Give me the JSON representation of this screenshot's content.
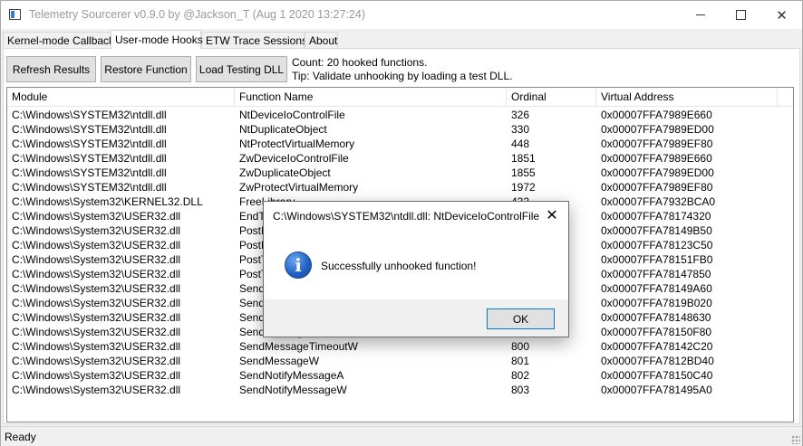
{
  "window": {
    "title": "Telemetry Sourcerer v0.9.0 by @Jackson_T (Aug  1 2020 13:27:24)",
    "controls": {
      "minimize": "minimize-icon",
      "maximize": "maximize-icon",
      "close": "close-icon"
    }
  },
  "tabs": [
    {
      "label": "Kernel-mode Callbacks",
      "active": false
    },
    {
      "label": "User-mode Hooks",
      "active": true
    },
    {
      "label": "ETW Trace Sessions",
      "active": false
    },
    {
      "label": "About",
      "active": false
    }
  ],
  "toolbar": {
    "refresh_label": "Refresh Results",
    "restore_label": "Restore Function",
    "load_label": "Load Testing DLL",
    "count_text": "Count: 20 hooked functions.",
    "tip_text": "Tip: Validate unhooking by loading a test DLL."
  },
  "table": {
    "columns": [
      "Module",
      "Function Name",
      "Ordinal",
      "Virtual Address"
    ],
    "rows": [
      [
        "C:\\Windows\\SYSTEM32\\ntdll.dll",
        "NtDeviceIoControlFile",
        "326",
        "0x00007FFA7989E660"
      ],
      [
        "C:\\Windows\\SYSTEM32\\ntdll.dll",
        "NtDuplicateObject",
        "330",
        "0x00007FFA7989ED00"
      ],
      [
        "C:\\Windows\\SYSTEM32\\ntdll.dll",
        "NtProtectVirtualMemory",
        "448",
        "0x00007FFA7989EF80"
      ],
      [
        "C:\\Windows\\SYSTEM32\\ntdll.dll",
        "ZwDeviceIoControlFile",
        "1851",
        "0x00007FFA7989E660"
      ],
      [
        "C:\\Windows\\SYSTEM32\\ntdll.dll",
        "ZwDuplicateObject",
        "1855",
        "0x00007FFA7989ED00"
      ],
      [
        "C:\\Windows\\SYSTEM32\\ntdll.dll",
        "ZwProtectVirtualMemory",
        "1972",
        "0x00007FFA7989EF80"
      ],
      [
        "C:\\Windows\\System32\\KERNEL32.DLL",
        "FreeLibrary",
        "433",
        "0x00007FFA7932BCA0"
      ],
      [
        "C:\\Windows\\System32\\USER32.dll",
        "EndTask",
        "",
        "0x00007FFA78174320"
      ],
      [
        "C:\\Windows\\System32\\USER32.dll",
        "PostMessageA",
        "",
        "0x00007FFA78149B50"
      ],
      [
        "C:\\Windows\\System32\\USER32.dll",
        "PostMessageW",
        "",
        "0x00007FFA78123C50"
      ],
      [
        "C:\\Windows\\System32\\USER32.dll",
        "PostThreadMessageA",
        "",
        "0x00007FFA78151FB0"
      ],
      [
        "C:\\Windows\\System32\\USER32.dll",
        "PostThreadMessageW",
        "",
        "0x00007FFA78147850"
      ],
      [
        "C:\\Windows\\System32\\USER32.dll",
        "SendMessageA",
        "",
        "0x00007FFA78149A60"
      ],
      [
        "C:\\Windows\\System32\\USER32.dll",
        "SendMessageCallbackA",
        "",
        "0x00007FFA7819B020"
      ],
      [
        "C:\\Windows\\System32\\USER32.dll",
        "SendMessageCallbackW",
        "",
        "0x00007FFA78148630"
      ],
      [
        "C:\\Windows\\System32\\USER32.dll",
        "SendMessageTimeoutA",
        "",
        "0x00007FFA78150F80"
      ],
      [
        "C:\\Windows\\System32\\USER32.dll",
        "SendMessageTimeoutW",
        "800",
        "0x00007FFA78142C20"
      ],
      [
        "C:\\Windows\\System32\\USER32.dll",
        "SendMessageW",
        "801",
        "0x00007FFA7812BD40"
      ],
      [
        "C:\\Windows\\System32\\USER32.dll",
        "SendNotifyMessageA",
        "802",
        "0x00007FFA78150C40"
      ],
      [
        "C:\\Windows\\System32\\USER32.dll",
        "SendNotifyMessageW",
        "803",
        "0x00007FFA781495A0"
      ]
    ]
  },
  "status": {
    "text": "Ready"
  },
  "dialog": {
    "title": "C:\\Windows\\SYSTEM32\\ntdll.dll: NtDeviceIoControlFile",
    "message": "Successfully unhooked function!",
    "ok_label": "OK",
    "icon": "info-icon"
  }
}
